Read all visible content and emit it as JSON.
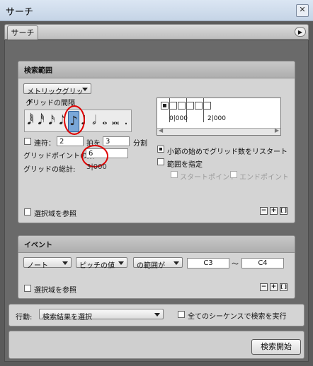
{
  "window": {
    "title": "サーチ",
    "close_glyph": "✕"
  },
  "tab": {
    "label": "サーチ",
    "play_glyph": "▶"
  },
  "search_range": {
    "header": "検索範囲",
    "mode_dropdown": "メトリックグリッド",
    "grid_interval_label": "グリッドの間隔",
    "notes": [
      "𝅘𝅥𝅱",
      "𝅘𝅥𝅰",
      "𝅘𝅥𝅯",
      "𝅘𝅥𝅮",
      "♪",
      "♩",
      "𝅗𝅥",
      "𝅝",
      "𝅜",
      "."
    ],
    "selected_note_index": 4,
    "tuplet_label": "連符：",
    "tuplet_value": "2",
    "beat_label": "拍を",
    "beat_value": "3",
    "split_label": "分割",
    "grid_points_label": "グリッドポイントの数：",
    "grid_points_value": "6",
    "grid_total_label": "グリッドの総計:",
    "grid_total_value": "3|000",
    "ruler_labels": [
      "0|000",
      "2|000"
    ],
    "restart_label": "小節の始めでグリッド数をリスタート",
    "restart_checked": true,
    "range_label": "範囲を指定",
    "range_checked": false,
    "start_point_label": "スタートポイント",
    "end_point_label": "エンドポイント",
    "ref_selection_label": "選択域を参照",
    "btn_minus": "−",
    "btn_plus": "+",
    "btn_bracket": "[ ]"
  },
  "event": {
    "header": "イベント",
    "type_dropdown": "ノート",
    "attr_dropdown": "ピッチの値",
    "cond_dropdown": "の範囲が",
    "from_value": "C3",
    "tilde": "〜",
    "to_value": "C4",
    "ref_selection_label": "選択域を参照",
    "btn_minus": "−",
    "btn_plus": "+",
    "btn_bracket": "[ ]"
  },
  "action": {
    "label": "行動:",
    "dropdown": "検索結果を選択",
    "all_sequences_label": "全てのシーケンスで検索を実行",
    "start_button": "検索開始"
  },
  "colors": {
    "annotation_red": "#e00000",
    "selected_note_bg": "#7aa7d8"
  }
}
